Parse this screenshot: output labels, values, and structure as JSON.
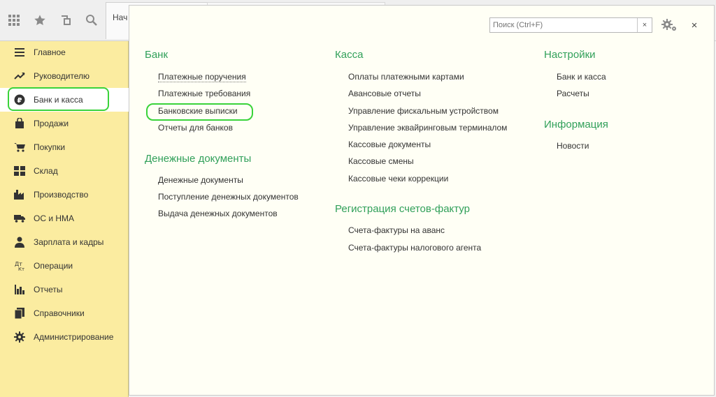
{
  "toolbar": {
    "icons": [
      "apps-grid-icon",
      "star-icon",
      "history-icon",
      "search-icon"
    ],
    "tab_start_label": "Нач"
  },
  "sidebar": {
    "items": [
      {
        "label": "Главное",
        "icon": "menu-lines-icon"
      },
      {
        "label": "Руководителю",
        "icon": "trend-icon"
      },
      {
        "label": "Банк и касса",
        "icon": "ruble-icon"
      },
      {
        "label": "Продажи",
        "icon": "bag-icon"
      },
      {
        "label": "Покупки",
        "icon": "cart-icon"
      },
      {
        "label": "Склад",
        "icon": "warehouse-icon"
      },
      {
        "label": "Производство",
        "icon": "factory-icon"
      },
      {
        "label": "ОС и НМА",
        "icon": "truck-icon"
      },
      {
        "label": "Зарплата и кадры",
        "icon": "person-icon"
      },
      {
        "label": "Операции",
        "icon": "operations-icon"
      },
      {
        "label": "Отчеты",
        "icon": "bar-chart-icon"
      },
      {
        "label": "Справочники",
        "icon": "book-icon"
      },
      {
        "label": "Администрирование",
        "icon": "gear-icon"
      }
    ],
    "active_index": 2
  },
  "panel": {
    "search_placeholder": "Поиск (Ctrl+F)",
    "clear_label": "×",
    "close_label": "×",
    "columns": {
      "bank": {
        "title": "Банк",
        "links": [
          "Платежные поручения",
          "Платежные требования",
          "Банковские выписки",
          "Отчеты для банков"
        ]
      },
      "money_docs": {
        "title": "Денежные документы",
        "links": [
          "Денежные документы",
          "Поступление денежных документов",
          "Выдача денежных документов"
        ]
      },
      "kassa": {
        "title": "Касса",
        "links": [
          "Оплаты платежными картами",
          "Авансовые отчеты",
          "Управление фискальным устройством",
          "Управление эквайринговым терминалом",
          "Кассовые документы",
          "Кассовые смены",
          "Кассовые чеки коррекции"
        ]
      },
      "invoices": {
        "title": "Регистрация счетов-фактур",
        "links": [
          "Счета-фактуры на аванс",
          "Счета-фактуры налогового агента"
        ]
      },
      "settings": {
        "title": "Настройки",
        "links": [
          "Банк и касса",
          "Расчеты"
        ]
      },
      "info": {
        "title": "Информация",
        "links": [
          "Новости"
        ]
      }
    }
  },
  "colors": {
    "accent_green": "#31a05a",
    "sidebar_bg": "#fbeca0",
    "highlight_ring": "#3ad33a"
  }
}
